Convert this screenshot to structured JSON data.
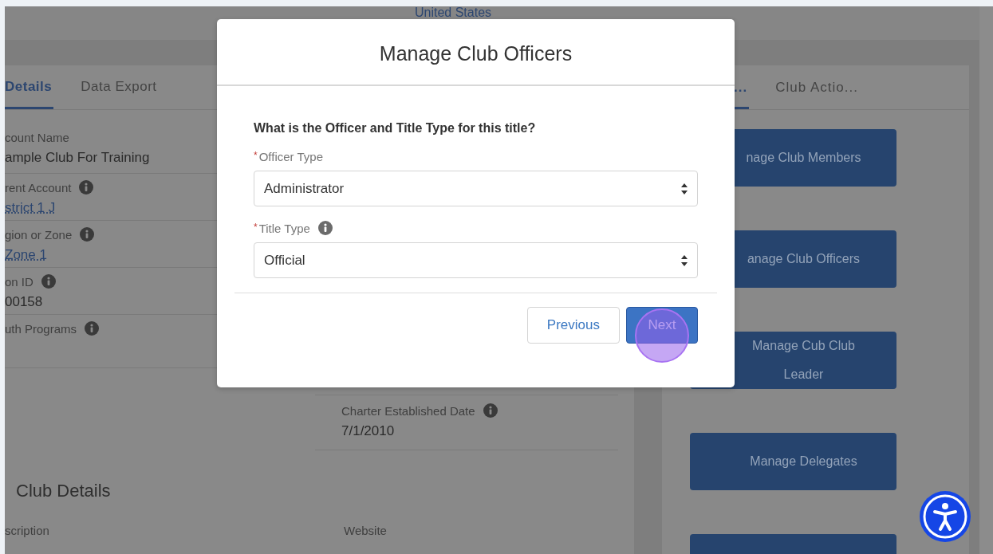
{
  "header": {
    "country": "United States"
  },
  "record_tabs": [
    {
      "label": "Details",
      "selected": true
    },
    {
      "label": "Data Export",
      "selected": false
    }
  ],
  "fields_left": [
    {
      "label": "count Name",
      "value": "ample Club For Training",
      "kind": "text",
      "info": false
    },
    {
      "label": "rent Account",
      "value": "strict 1 J",
      "kind": "link",
      "info": true
    },
    {
      "label": "gion or Zone",
      "value": "Zone 1",
      "kind": "link",
      "info": true
    },
    {
      "label": "on ID",
      "value": "00158",
      "kind": "text",
      "info": true
    },
    {
      "label": "uth Programs",
      "info": true
    }
  ],
  "fields_right": [
    {
      "label": "Charter Established Date",
      "value": "7/1/2010",
      "kind": "text",
      "info": true
    }
  ],
  "section": {
    "title": "Club Details",
    "fields": [
      {
        "label": "scription"
      },
      {
        "label": "Website"
      }
    ]
  },
  "action_tabs": [
    {
      "label": "...",
      "selected": true
    },
    {
      "label": "Club Actio...",
      "selected": false
    }
  ],
  "actions": [
    "nage Club Members",
    "anage Club Officers",
    "Manage Cub Club Leader",
    "Manage Delegates"
  ],
  "modal": {
    "title": "Manage Club Officers",
    "question": "What is the Officer and Title Type for this title?",
    "fields": [
      {
        "required_mark": "*",
        "label": "Officer Type",
        "info": false,
        "value": "Administrator"
      },
      {
        "required_mark": "*",
        "label": "Title Type",
        "info": true,
        "value": "Official"
      }
    ],
    "buttons": [
      {
        "label": "Previous",
        "kind": "neutral"
      },
      {
        "label": "Next",
        "kind": "brand"
      }
    ]
  }
}
